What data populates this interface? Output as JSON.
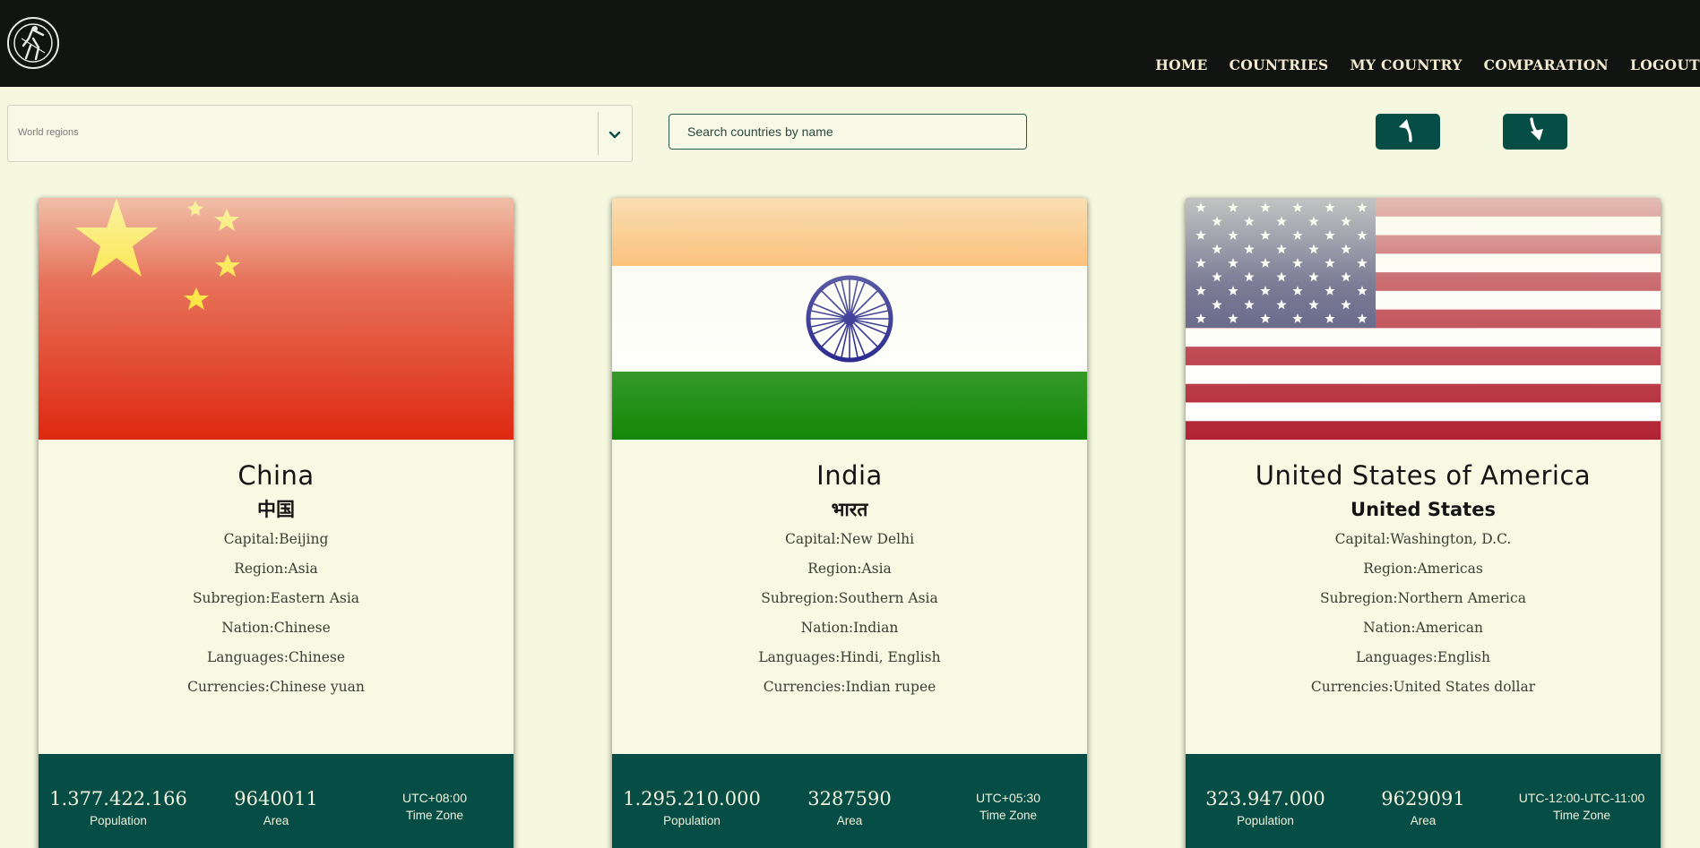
{
  "nav": {
    "items": [
      {
        "label": "HOME"
      },
      {
        "label": "COUNTRIES"
      },
      {
        "label": "MY COUNTRY"
      },
      {
        "label": "COMPARATION"
      },
      {
        "label": "LOGOUT"
      }
    ]
  },
  "filters": {
    "region_placeholder": "World regions",
    "search_placeholder": "Search countries by name"
  },
  "colors": {
    "nav_background": "#121412",
    "page_background": "#f5f8df",
    "accent": "#054d45"
  },
  "cards": [
    {
      "name": "China",
      "native_name": "中国",
      "capital_label": "Capital:",
      "capital": "Beijing",
      "region_label": "Region:",
      "region": "Asia",
      "subregion_label": "Subregion:",
      "subregion": "Eastern Asia",
      "nation_label": "Nation:",
      "nation": "Chinese",
      "languages_label": "Languages:",
      "languages": "Chinese",
      "currencies_label": "Currencies:",
      "currencies": "Chinese yuan",
      "population": "1.377.422.166",
      "population_label": "Population",
      "area": "9640011",
      "area_label": "Area",
      "timezone": "UTC+08:00",
      "timezone_label": "Time Zone"
    },
    {
      "name": "India",
      "native_name": "भारत",
      "capital_label": "Capital:",
      "capital": "New Delhi",
      "region_label": "Region:",
      "region": "Asia",
      "subregion_label": "Subregion:",
      "subregion": "Southern Asia",
      "nation_label": "Nation:",
      "nation": "Indian",
      "languages_label": "Languages:",
      "languages": "Hindi, English",
      "currencies_label": "Currencies:",
      "currencies": "Indian rupee",
      "population": "1.295.210.000",
      "population_label": "Population",
      "area": "3287590",
      "area_label": "Area",
      "timezone": "UTC+05:30",
      "timezone_label": "Time Zone"
    },
    {
      "name": "United States of America",
      "native_name": "United States",
      "capital_label": "Capital:",
      "capital": "Washington, D.C.",
      "region_label": "Region:",
      "region": "Americas",
      "subregion_label": "Subregion:",
      "subregion": "Northern America",
      "nation_label": "Nation:",
      "nation": "American",
      "languages_label": "Languages:",
      "languages": "English",
      "currencies_label": "Currencies:",
      "currencies": "United States dollar",
      "population": "323.947.000",
      "population_label": "Population",
      "area": "9629091",
      "area_label": "Area",
      "timezone": "UTC-12:00-UTC-11:00",
      "timezone_label": "Time Zone"
    }
  ]
}
